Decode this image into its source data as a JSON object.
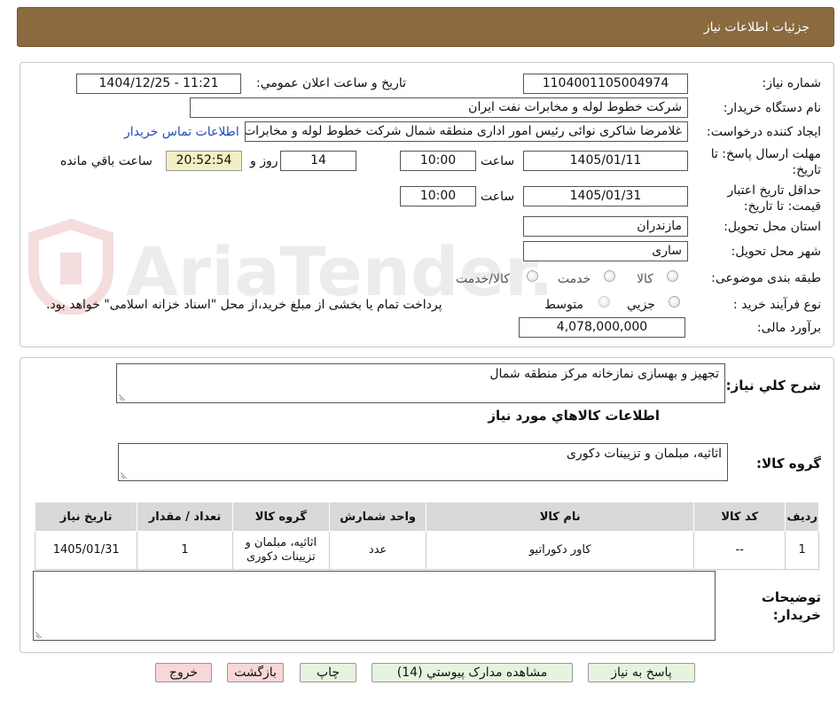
{
  "header": {
    "title": "جزئیات اطلاعات نیاز"
  },
  "watermark": {
    "text": "AriaTender.neT"
  },
  "form": {
    "need_number": {
      "label": "شماره نیاز:",
      "value": "1104001105004974"
    },
    "announce": {
      "label": "تاریخ و ساعت اعلان عمومي:",
      "value": "1404/12/25 - 11:21"
    },
    "buyer": {
      "label": "نام دستگاه خریدار:",
      "value": "شرکت خطوط لوله و مخابرات نفت ایران"
    },
    "requester": {
      "label": "ایجاد کننده درخواست:",
      "value": "غلامرضا شاکری نوائی رئیس امور اداری منطقه شمال  شرکت خطوط لوله و مخابرات",
      "contact_link": "اطلاعات تماس خریدار"
    },
    "deadline": {
      "label": "مهلت ارسال پاسخ: تا تاریخ:",
      "date": "1405/01/11",
      "time_label": "ساعت",
      "time": "10:00",
      "days": "14",
      "days_label": "روز و",
      "remaining": "20:52:54",
      "remaining_label": "ساعت باقي مانده"
    },
    "validity": {
      "label": "حداقل تاریخ اعتبار قیمت: تا تاریخ:",
      "date": "1405/01/31",
      "time_label": "ساعت",
      "time": "10:00"
    },
    "province": {
      "label": "استان محل تحویل:",
      "value": "مازندران"
    },
    "city": {
      "label": "شهر محل تحویل:",
      "value": "ساری"
    },
    "category": {
      "label": "طبقه بندی موضوعی:",
      "options": [
        "کالا",
        "خدمت",
        "کالا/خدمت"
      ]
    },
    "purchase_type": {
      "label": "نوع فرآیند خرید :",
      "options": [
        "جزیي",
        "متوسط"
      ],
      "note": "پرداخت تمام یا بخشی از مبلغ خرید،از محل \"اسناد خزانه اسلامی\" خواهد بود."
    },
    "budget": {
      "label": "برآورد مالی:",
      "value": "4,078,000,000"
    }
  },
  "details": {
    "general_label": "شرح کلي نیاز:",
    "general_text": "تجهیز و بهسازی نمازخانه مرکز منطقه شمال",
    "goods_heading": "اطلاعات کالاهاي مورد نیاز",
    "goods_group_label": "گروه کالا:",
    "goods_group_value": "اثاثیه، مبلمان و تزیینات دکوری",
    "table": {
      "headers": [
        "ردیف",
        "کد کالا",
        "نام کالا",
        "واحد شمارش",
        "گروه کالا",
        "تعداد / مقدار",
        "تاریخ نیاز"
      ],
      "rows": [
        [
          "1",
          "--",
          "کاور دکوراتیو",
          "عدد",
          "اثاثیه، مبلمان و تزیینات دکوری",
          "1",
          "1405/01/31"
        ]
      ]
    },
    "buyer_notes_label": "توضیحات خریدار:",
    "buyer_notes_value": ""
  },
  "buttons": {
    "reply": "پاسخ به نیاز",
    "attachments": "مشاهده مدارک پیوستي (14)",
    "print": "چاپ",
    "back": "بازگشت",
    "exit": "خروج"
  },
  "colors": {
    "header": "#8b6a3f",
    "remaining_bg": "#f3efc4",
    "link": "#1d4fb8"
  }
}
